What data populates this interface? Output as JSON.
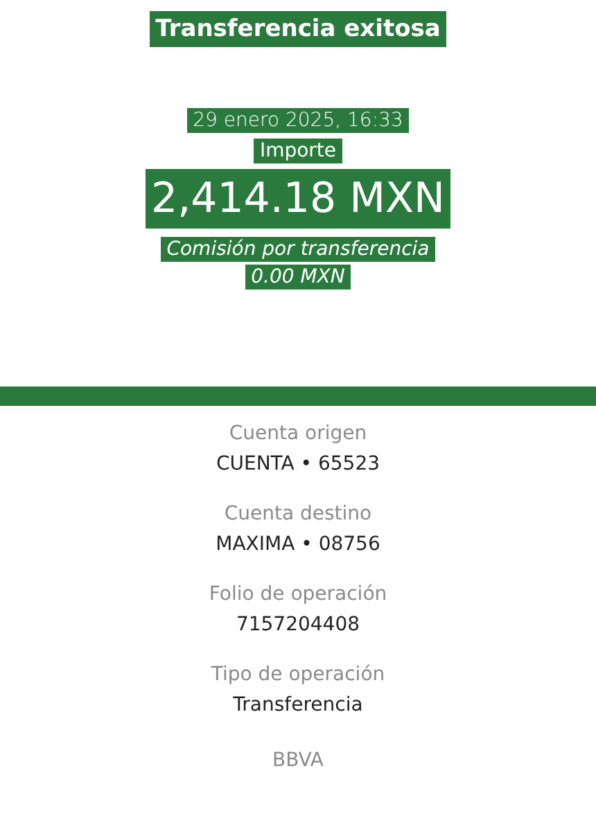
{
  "header": {
    "title": "Transferencia exitosa",
    "date": "29 enero 2025, 16:33",
    "amount_label": "Importe",
    "amount": "2,414.18 MXN",
    "fee_label": "Comisión por transferencia",
    "fee": "0.00 MXN"
  },
  "details": [
    {
      "label": "Cuenta origen",
      "value": "CUENTA • 65523"
    },
    {
      "label": "Cuenta destino",
      "value": "MAXIMA • 08756"
    },
    {
      "label": "Folio de operación",
      "value": "7157204408"
    },
    {
      "label": "Tipo de operación",
      "value": "Transferencia"
    }
  ],
  "footer": "BBVA"
}
